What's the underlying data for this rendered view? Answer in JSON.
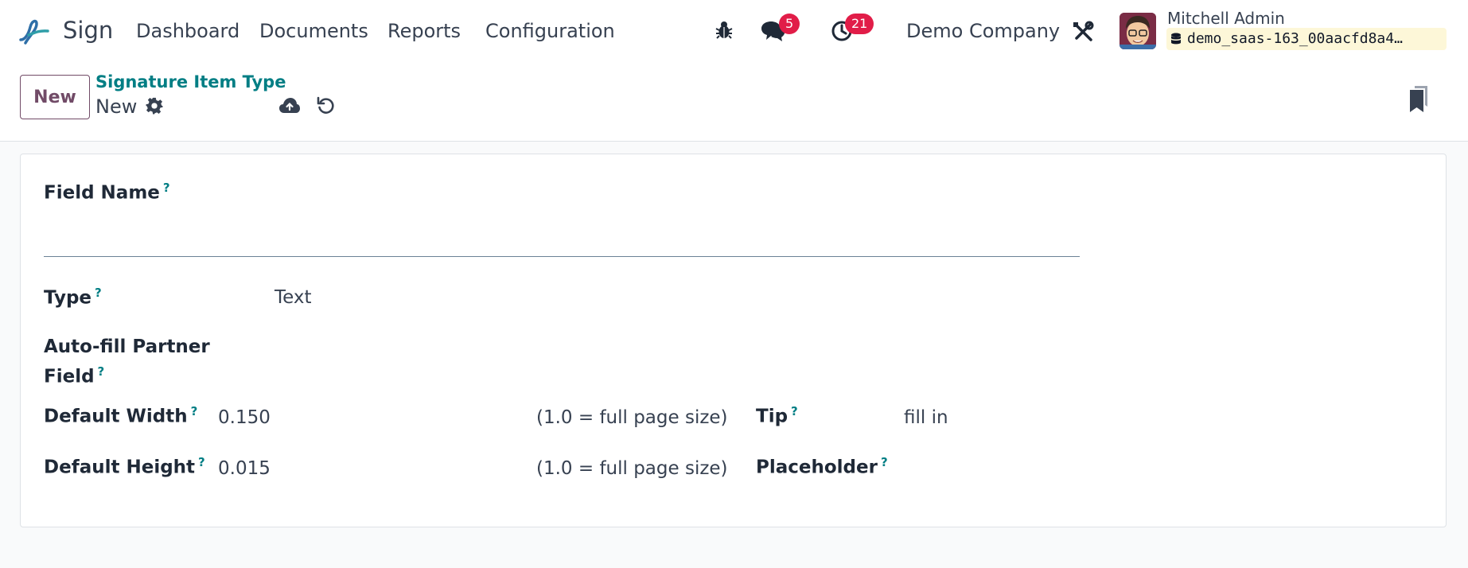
{
  "app": {
    "name": "Sign",
    "menu": [
      "Dashboard",
      "Documents",
      "Reports",
      "Configuration"
    ]
  },
  "systray": {
    "messages_count": "5",
    "activities_count": "21",
    "company": "Demo Company",
    "user_name": "Mitchell Admin",
    "database": "demo_saas-163_00aacfd8a4…"
  },
  "control_panel": {
    "new_button": "New",
    "breadcrumb": "Signature Item Type",
    "record_title": "New"
  },
  "form": {
    "field_name": {
      "label": "Field Name",
      "help": "?",
      "value": ""
    },
    "type": {
      "label": "Type",
      "help": "?",
      "value": "Text"
    },
    "auto_fill": {
      "label_line1": "Auto-fill Partner",
      "label_line2": "Field",
      "help": "?",
      "value": ""
    },
    "default_width": {
      "label": "Default Width",
      "help": "?",
      "value": "0.150",
      "hint": "(1.0 = full page size)"
    },
    "default_height": {
      "label": "Default Height",
      "help": "?",
      "value": "0.015",
      "hint": "(1.0 = full page size)"
    },
    "tip": {
      "label": "Tip",
      "help": "?",
      "value": "fill in"
    },
    "placeholder": {
      "label": "Placeholder",
      "help": "?",
      "value": ""
    }
  },
  "colors": {
    "brand": "#714b67",
    "link": "#017e84",
    "badge": "#e11d48",
    "db_chip": "#fdf7d8"
  },
  "icons": [
    "sign-logo-icon",
    "bug-icon",
    "chat-icon",
    "clock-icon",
    "tools-icon",
    "database-icon",
    "gear-icon",
    "cloud-upload-icon",
    "undo-icon",
    "bookmark-icon"
  ]
}
